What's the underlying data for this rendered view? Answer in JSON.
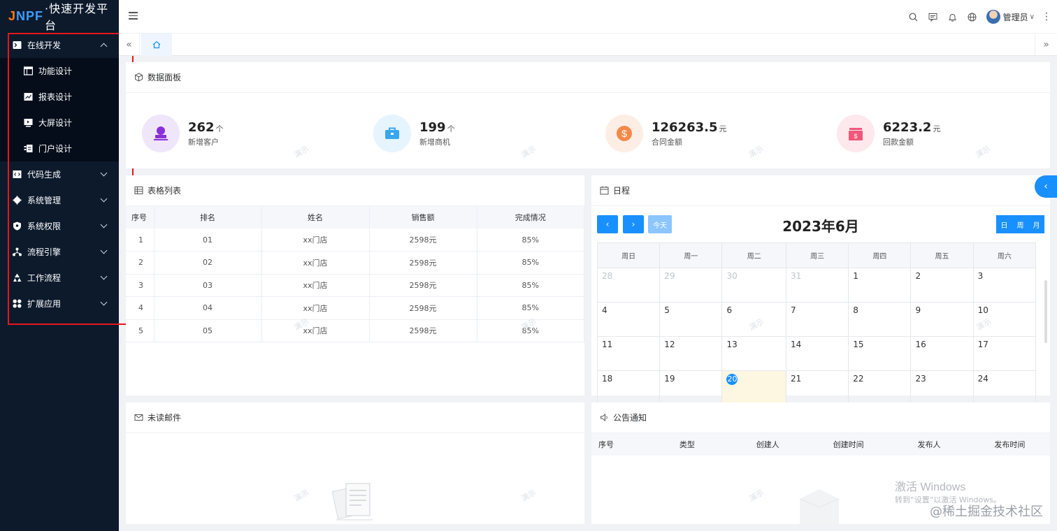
{
  "app": {
    "brand": "JNPF",
    "subtitle": "·快速开发平台"
  },
  "sidebar": {
    "menu": [
      {
        "label": "在线开发",
        "expanded": true,
        "icon": "terminal-icon",
        "children": [
          {
            "label": "功能设计",
            "icon": "table-icon"
          },
          {
            "label": "报表设计",
            "icon": "line-chart-icon"
          },
          {
            "label": "大屏设计",
            "icon": "screen-icon"
          },
          {
            "label": "门户设计",
            "icon": "portal-icon"
          }
        ]
      },
      {
        "label": "代码生成",
        "icon": "code-icon"
      },
      {
        "label": "系统管理",
        "icon": "gear-icon"
      },
      {
        "label": "系统权限",
        "icon": "shield-icon"
      },
      {
        "label": "流程引擎",
        "icon": "flow-icon"
      },
      {
        "label": "工作流程",
        "icon": "recycle-icon"
      },
      {
        "label": "扩展应用",
        "icon": "apps-icon"
      }
    ]
  },
  "header": {
    "user": "管理员"
  },
  "stats": {
    "title": "数据面板",
    "items": [
      {
        "value": "262",
        "unit": "个",
        "label": "新增客户",
        "color": "#8b2fd9",
        "bg": "#efe6fb"
      },
      {
        "value": "199",
        "unit": "个",
        "label": "新增商机",
        "color": "#3aa6ee",
        "bg": "#e6f4fd"
      },
      {
        "value": "126263.5",
        "unit": "元",
        "label": "合同金额",
        "color": "#f5894a",
        "bg": "#fdeee5"
      },
      {
        "value": "6223.2",
        "unit": "元",
        "label": "回款金额",
        "color": "#f0587a",
        "bg": "#fde8ee"
      }
    ]
  },
  "table": {
    "title": "表格列表",
    "headers": [
      "序号",
      "排名",
      "姓名",
      "销售额",
      "完成情况"
    ],
    "rows": [
      [
        "1",
        "01",
        "xx门店",
        "2598元",
        "85%"
      ],
      [
        "2",
        "02",
        "xx门店",
        "2598元",
        "85%"
      ],
      [
        "3",
        "03",
        "xx门店",
        "2598元",
        "85%"
      ],
      [
        "4",
        "04",
        "xx门店",
        "2598元",
        "85%"
      ],
      [
        "5",
        "05",
        "xx门店",
        "2598元",
        "85%"
      ]
    ]
  },
  "calendar": {
    "title": "日程",
    "month_title": "2023年6月",
    "today_label": "今天",
    "views": [
      "日",
      "周",
      "月"
    ],
    "weekdays": [
      "周日",
      "周一",
      "周二",
      "周三",
      "周四",
      "周五",
      "周六"
    ],
    "weeks": [
      [
        {
          "d": "28",
          "o": true
        },
        {
          "d": "29",
          "o": true
        },
        {
          "d": "30",
          "o": true
        },
        {
          "d": "31",
          "o": true
        },
        {
          "d": "1"
        },
        {
          "d": "2"
        },
        {
          "d": "3"
        }
      ],
      [
        {
          "d": "4"
        },
        {
          "d": "5"
        },
        {
          "d": "6"
        },
        {
          "d": "7"
        },
        {
          "d": "8"
        },
        {
          "d": "9"
        },
        {
          "d": "10"
        }
      ],
      [
        {
          "d": "11"
        },
        {
          "d": "12"
        },
        {
          "d": "13"
        },
        {
          "d": "14"
        },
        {
          "d": "15"
        },
        {
          "d": "16"
        },
        {
          "d": "17"
        }
      ],
      [
        {
          "d": "18"
        },
        {
          "d": "19"
        },
        {
          "d": "20",
          "today": true
        },
        {
          "d": "21"
        },
        {
          "d": "22"
        },
        {
          "d": "23"
        },
        {
          "d": "24"
        }
      ]
    ]
  },
  "mail": {
    "title": "未读邮件"
  },
  "notice": {
    "title": "公告通知",
    "headers": [
      "序号",
      "类型",
      "创建人",
      "创建时间",
      "发布人",
      "发布时间"
    ]
  },
  "watermark": "演示",
  "windows": {
    "line1": "激活 Windows",
    "line2": "转到“设置”以激活 Windows。"
  },
  "credit": "@稀土掘金技术社区"
}
